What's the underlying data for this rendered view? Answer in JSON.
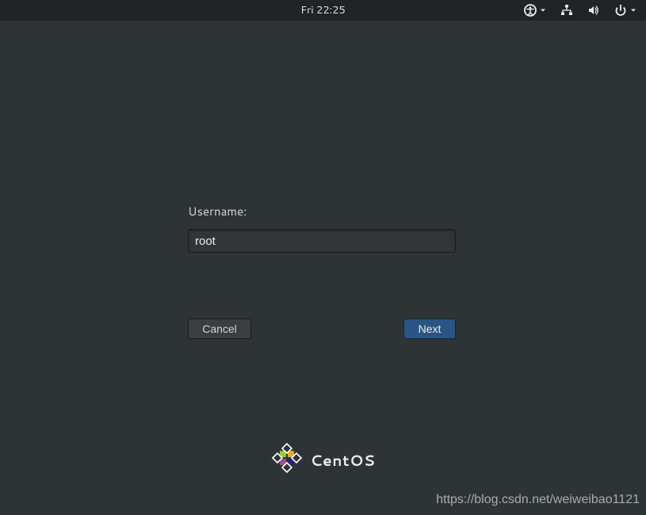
{
  "topbar": {
    "clock": "Fri 22:25"
  },
  "login": {
    "username_label": "Username:",
    "username_value": "root",
    "cancel_label": "Cancel",
    "next_label": "Next"
  },
  "branding": {
    "text": "CentOS"
  },
  "watermark": "https://blog.csdn.net/weiweibao1121"
}
